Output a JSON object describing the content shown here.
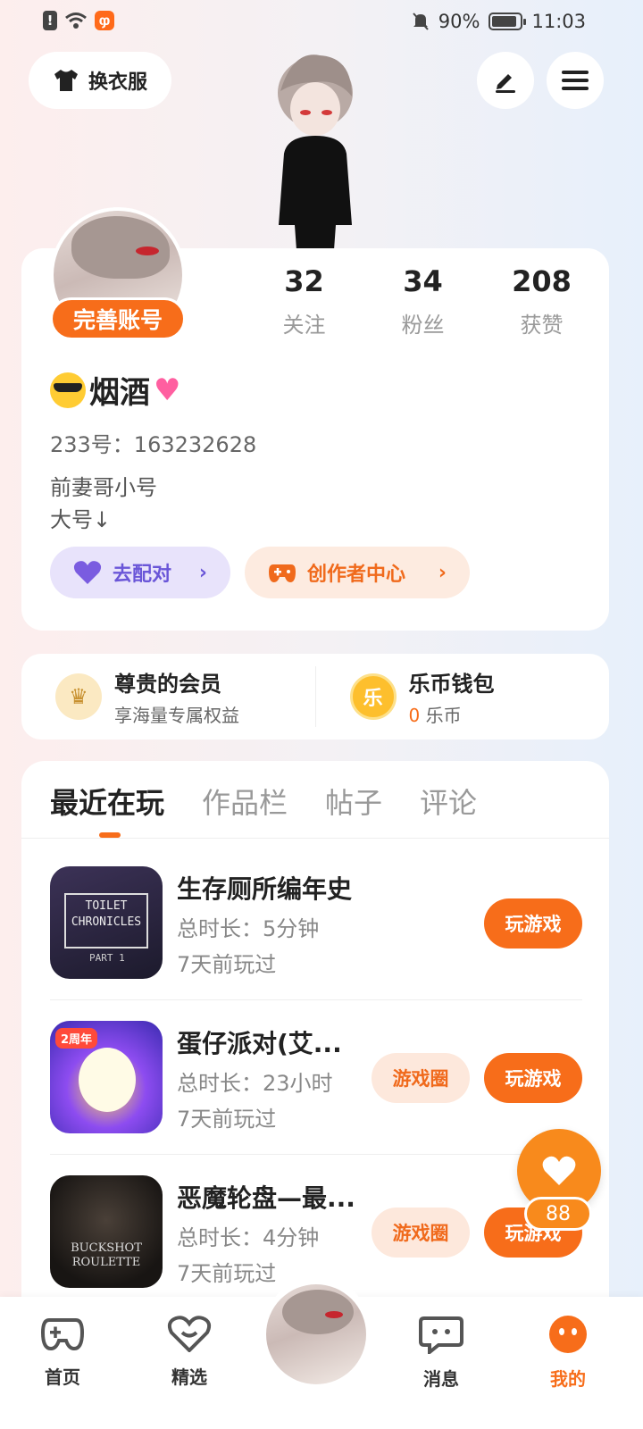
{
  "status_bar": {
    "battery": "90%",
    "battery_level": 0.9,
    "time": "11:03"
  },
  "top": {
    "outfit_label": "换衣服"
  },
  "profile": {
    "complete_label": "完善账号",
    "stats": [
      {
        "value": "32",
        "label": "关注"
      },
      {
        "value": "34",
        "label": "粉丝"
      },
      {
        "value": "208",
        "label": "获赞"
      }
    ],
    "nickname": "烟酒",
    "uid": "233号：163232628",
    "bio_line1": "前妻哥小号",
    "bio_line2": "大号↓",
    "match_label": "去配对",
    "creator_label": "创作者中心"
  },
  "member": {
    "vip_title": "尊贵的会员",
    "vip_sub": "享海量专属权益",
    "wallet_title": "乐币钱包",
    "wallet_coin_glyph": "乐",
    "wallet_amount": "0",
    "wallet_unit": "乐币"
  },
  "tabs": [
    "最近在玩",
    "作品栏",
    "帖子",
    "评论"
  ],
  "games": [
    {
      "title": "生存厕所编年史",
      "duration": "总时长：5分钟",
      "last_played": "7天前玩过",
      "play_label": "玩游戏",
      "circle_label": "",
      "thumb_text": "TOILET CHRONICLES",
      "thumb_sub": "PART 1"
    },
    {
      "title": "蛋仔派对(艾...",
      "duration": "总时长：23小时",
      "last_played": "7天前玩过",
      "play_label": "玩游戏",
      "circle_label": "游戏圈",
      "thumb_badge": "2周年"
    },
    {
      "title": "恶魔轮盘—最...",
      "duration": "总时长：4分钟",
      "last_played": "7天前玩过",
      "play_label": "玩游戏",
      "circle_label": "游戏圈",
      "thumb_text": "BUCKSHOT ROULETTE"
    }
  ],
  "fab": {
    "count": "88"
  },
  "nav": [
    {
      "label": "首页",
      "icon": "gamepad-icon"
    },
    {
      "label": "精选",
      "icon": "heart-chat-icon"
    },
    {
      "label": "消息",
      "icon": "message-icon"
    },
    {
      "label": "我的",
      "icon": "smile-icon"
    }
  ],
  "colors": {
    "accent": "#f76d1a",
    "purple": "#6a56d8"
  }
}
